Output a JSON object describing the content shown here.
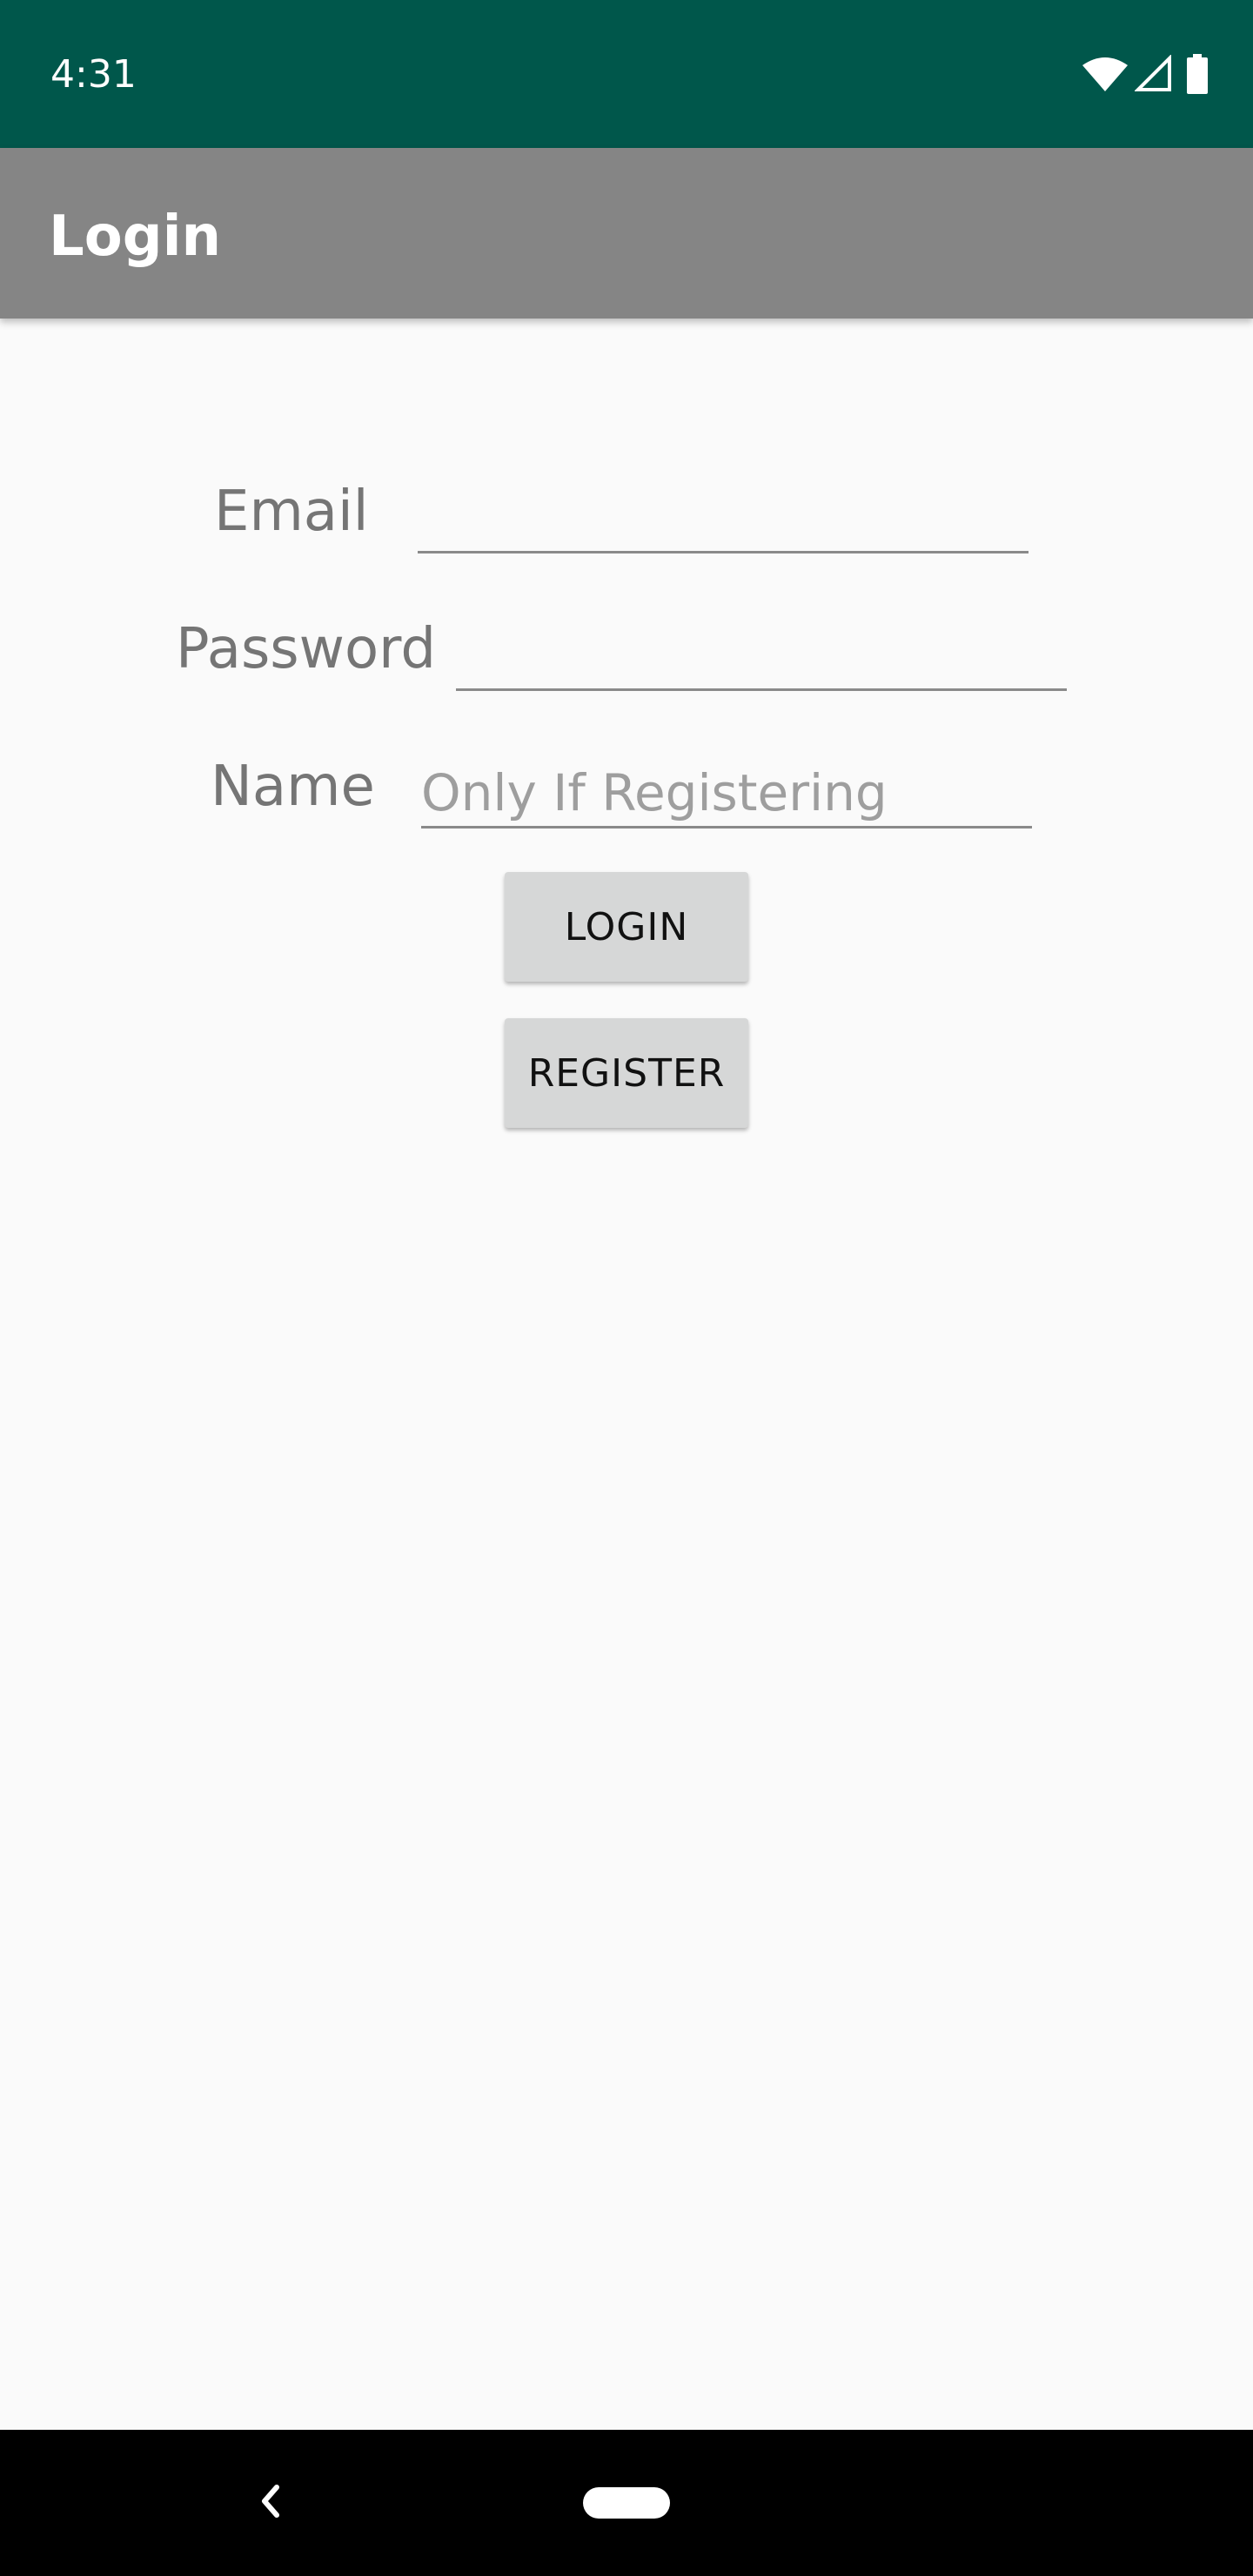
{
  "status_bar": {
    "time": "4:31",
    "icons": [
      "wifi-icon",
      "cell-signal-icon",
      "battery-icon"
    ],
    "color": "#00574b"
  },
  "app_bar": {
    "title": "Login",
    "color": "#858585"
  },
  "form": {
    "email": {
      "label": "Email",
      "value": "",
      "placeholder": ""
    },
    "password": {
      "label": "Password",
      "value": "",
      "placeholder": ""
    },
    "name": {
      "label": "Name",
      "value": "",
      "placeholder": "Only If Registering"
    }
  },
  "buttons": {
    "login": "LOGIN",
    "register": "REGISTER"
  },
  "nav_bar": {
    "icons": [
      "back-icon",
      "home-pill-icon"
    ]
  }
}
